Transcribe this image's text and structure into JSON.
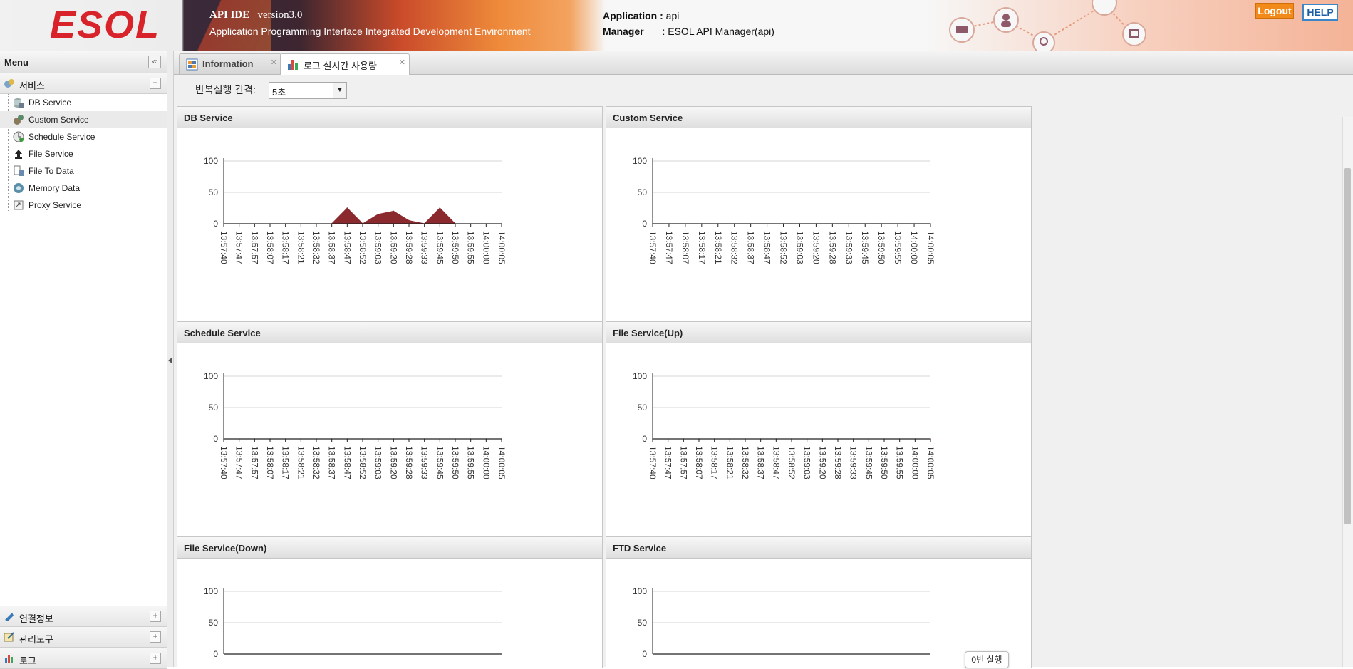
{
  "header": {
    "logo": "ESOL",
    "ide_name": "API IDE",
    "version": "version3.0",
    "subtitle": "Application Programming Interface Integrated Development Environment",
    "application_label": "Application :",
    "application_value": "api",
    "manager_label": "Manager",
    "manager_value": ": ESOL API Manager(api)",
    "logout_label": "Logout",
    "help_label": "HELP",
    "brand_color": "#d8232a"
  },
  "sidebar": {
    "title": "Menu",
    "service_group": "서비스",
    "items": [
      {
        "label": "DB Service",
        "icon": "database-icon"
      },
      {
        "label": "Custom Service",
        "icon": "gears-icon"
      },
      {
        "label": "Schedule Service",
        "icon": "clock-icon"
      },
      {
        "label": "File Service",
        "icon": "upload-icon"
      },
      {
        "label": "File To Data",
        "icon": "file-data-icon"
      },
      {
        "label": "Memory Data",
        "icon": "memory-disc-icon"
      },
      {
        "label": "Proxy Service",
        "icon": "proxy-icon"
      }
    ],
    "selected_index": 1,
    "bottom_groups": [
      {
        "label": "연결정보",
        "icon": "link-icon"
      },
      {
        "label": "관리도구",
        "icon": "tools-icon"
      },
      {
        "label": "로그",
        "icon": "log-icon"
      }
    ]
  },
  "tabs": [
    {
      "label": "Information",
      "icon": "info-grid-icon",
      "active": false
    },
    {
      "label": "로그 실시간 사용량",
      "icon": "bar-chart-icon",
      "active": true
    }
  ],
  "controls": {
    "interval_label": "반복실행 간격:",
    "interval_value": "5초"
  },
  "toast": "0번 실행",
  "chart_data": [
    {
      "type": "area",
      "title": "DB Service",
      "categories": [
        "13:57:40",
        "13:57:47",
        "13:57:57",
        "13:58:07",
        "13:58:17",
        "13:58:21",
        "13:58:32",
        "13:58:37",
        "13:58:47",
        "13:58:52",
        "13:59:03",
        "13:59:20",
        "13:59:28",
        "13:59:33",
        "13:59:45",
        "13:59:50",
        "13:59:55",
        "14:00:00",
        "14:00:05"
      ],
      "values": [
        0,
        0,
        0,
        0,
        0,
        0,
        0,
        0,
        25,
        0,
        15,
        20,
        5,
        0,
        25,
        0,
        0,
        0,
        0
      ],
      "extra_points": [
        {
          "x_index": 6.0,
          "y": 10
        }
      ],
      "ylim": [
        0,
        100
      ],
      "yticks": [
        0,
        50,
        100
      ],
      "color": "#8b2a2e"
    },
    {
      "type": "area",
      "title": "Custom Service",
      "categories": [
        "13:57:40",
        "13:57:47",
        "13:58:07",
        "13:58:17",
        "13:58:21",
        "13:58:32",
        "13:58:37",
        "13:58:47",
        "13:58:52",
        "13:59:03",
        "13:59:20",
        "13:59:28",
        "13:59:33",
        "13:59:45",
        "13:59:50",
        "13:59:55",
        "14:00:00",
        "14:00:05"
      ],
      "values": [
        0,
        0,
        0,
        0,
        0,
        0,
        0,
        0,
        0,
        0,
        0,
        0,
        0,
        0,
        0,
        0,
        0,
        0
      ],
      "ylim": [
        0,
        100
      ],
      "yticks": [
        0,
        50,
        100
      ],
      "color": "#8b2a2e"
    },
    {
      "type": "area",
      "title": "Schedule Service",
      "categories": [
        "13:57:40",
        "13:57:47",
        "13:57:57",
        "13:58:07",
        "13:58:17",
        "13:58:21",
        "13:58:32",
        "13:58:37",
        "13:58:47",
        "13:58:52",
        "13:59:03",
        "13:59:20",
        "13:59:28",
        "13:59:33",
        "13:59:45",
        "13:59:50",
        "13:59:55",
        "14:00:00",
        "14:00:05"
      ],
      "values": [
        0,
        0,
        0,
        0,
        0,
        0,
        0,
        0,
        0,
        0,
        0,
        0,
        0,
        0,
        0,
        0,
        0,
        0,
        0
      ],
      "ylim": [
        0,
        100
      ],
      "yticks": [
        0,
        50,
        100
      ],
      "color": "#8b2a2e"
    },
    {
      "type": "area",
      "title": "File Service(Up)",
      "categories": [
        "13:57:40",
        "13:57:47",
        "13:57:57",
        "13:58:07",
        "13:58:17",
        "13:58:21",
        "13:58:32",
        "13:58:37",
        "13:58:47",
        "13:58:52",
        "13:59:03",
        "13:59:20",
        "13:59:28",
        "13:59:33",
        "13:59:45",
        "13:59:50",
        "13:59:55",
        "14:00:00",
        "14:00:05"
      ],
      "values": [
        0,
        0,
        0,
        0,
        0,
        0,
        0,
        0,
        0,
        0,
        0,
        0,
        0,
        0,
        0,
        0,
        0,
        0,
        0
      ],
      "ylim": [
        0,
        100
      ],
      "yticks": [
        0,
        50,
        100
      ],
      "color": "#8b2a2e"
    },
    {
      "type": "area",
      "title": "File Service(Down)",
      "categories": [],
      "values": [],
      "ylim": [
        0,
        100
      ],
      "yticks": [
        0,
        50,
        100
      ],
      "color": "#8b2a2e"
    },
    {
      "type": "area",
      "title": "FTD Service",
      "categories": [],
      "values": [],
      "ylim": [
        0,
        100
      ],
      "yticks": [
        0,
        50,
        100
      ],
      "color": "#8b2a2e"
    }
  ]
}
